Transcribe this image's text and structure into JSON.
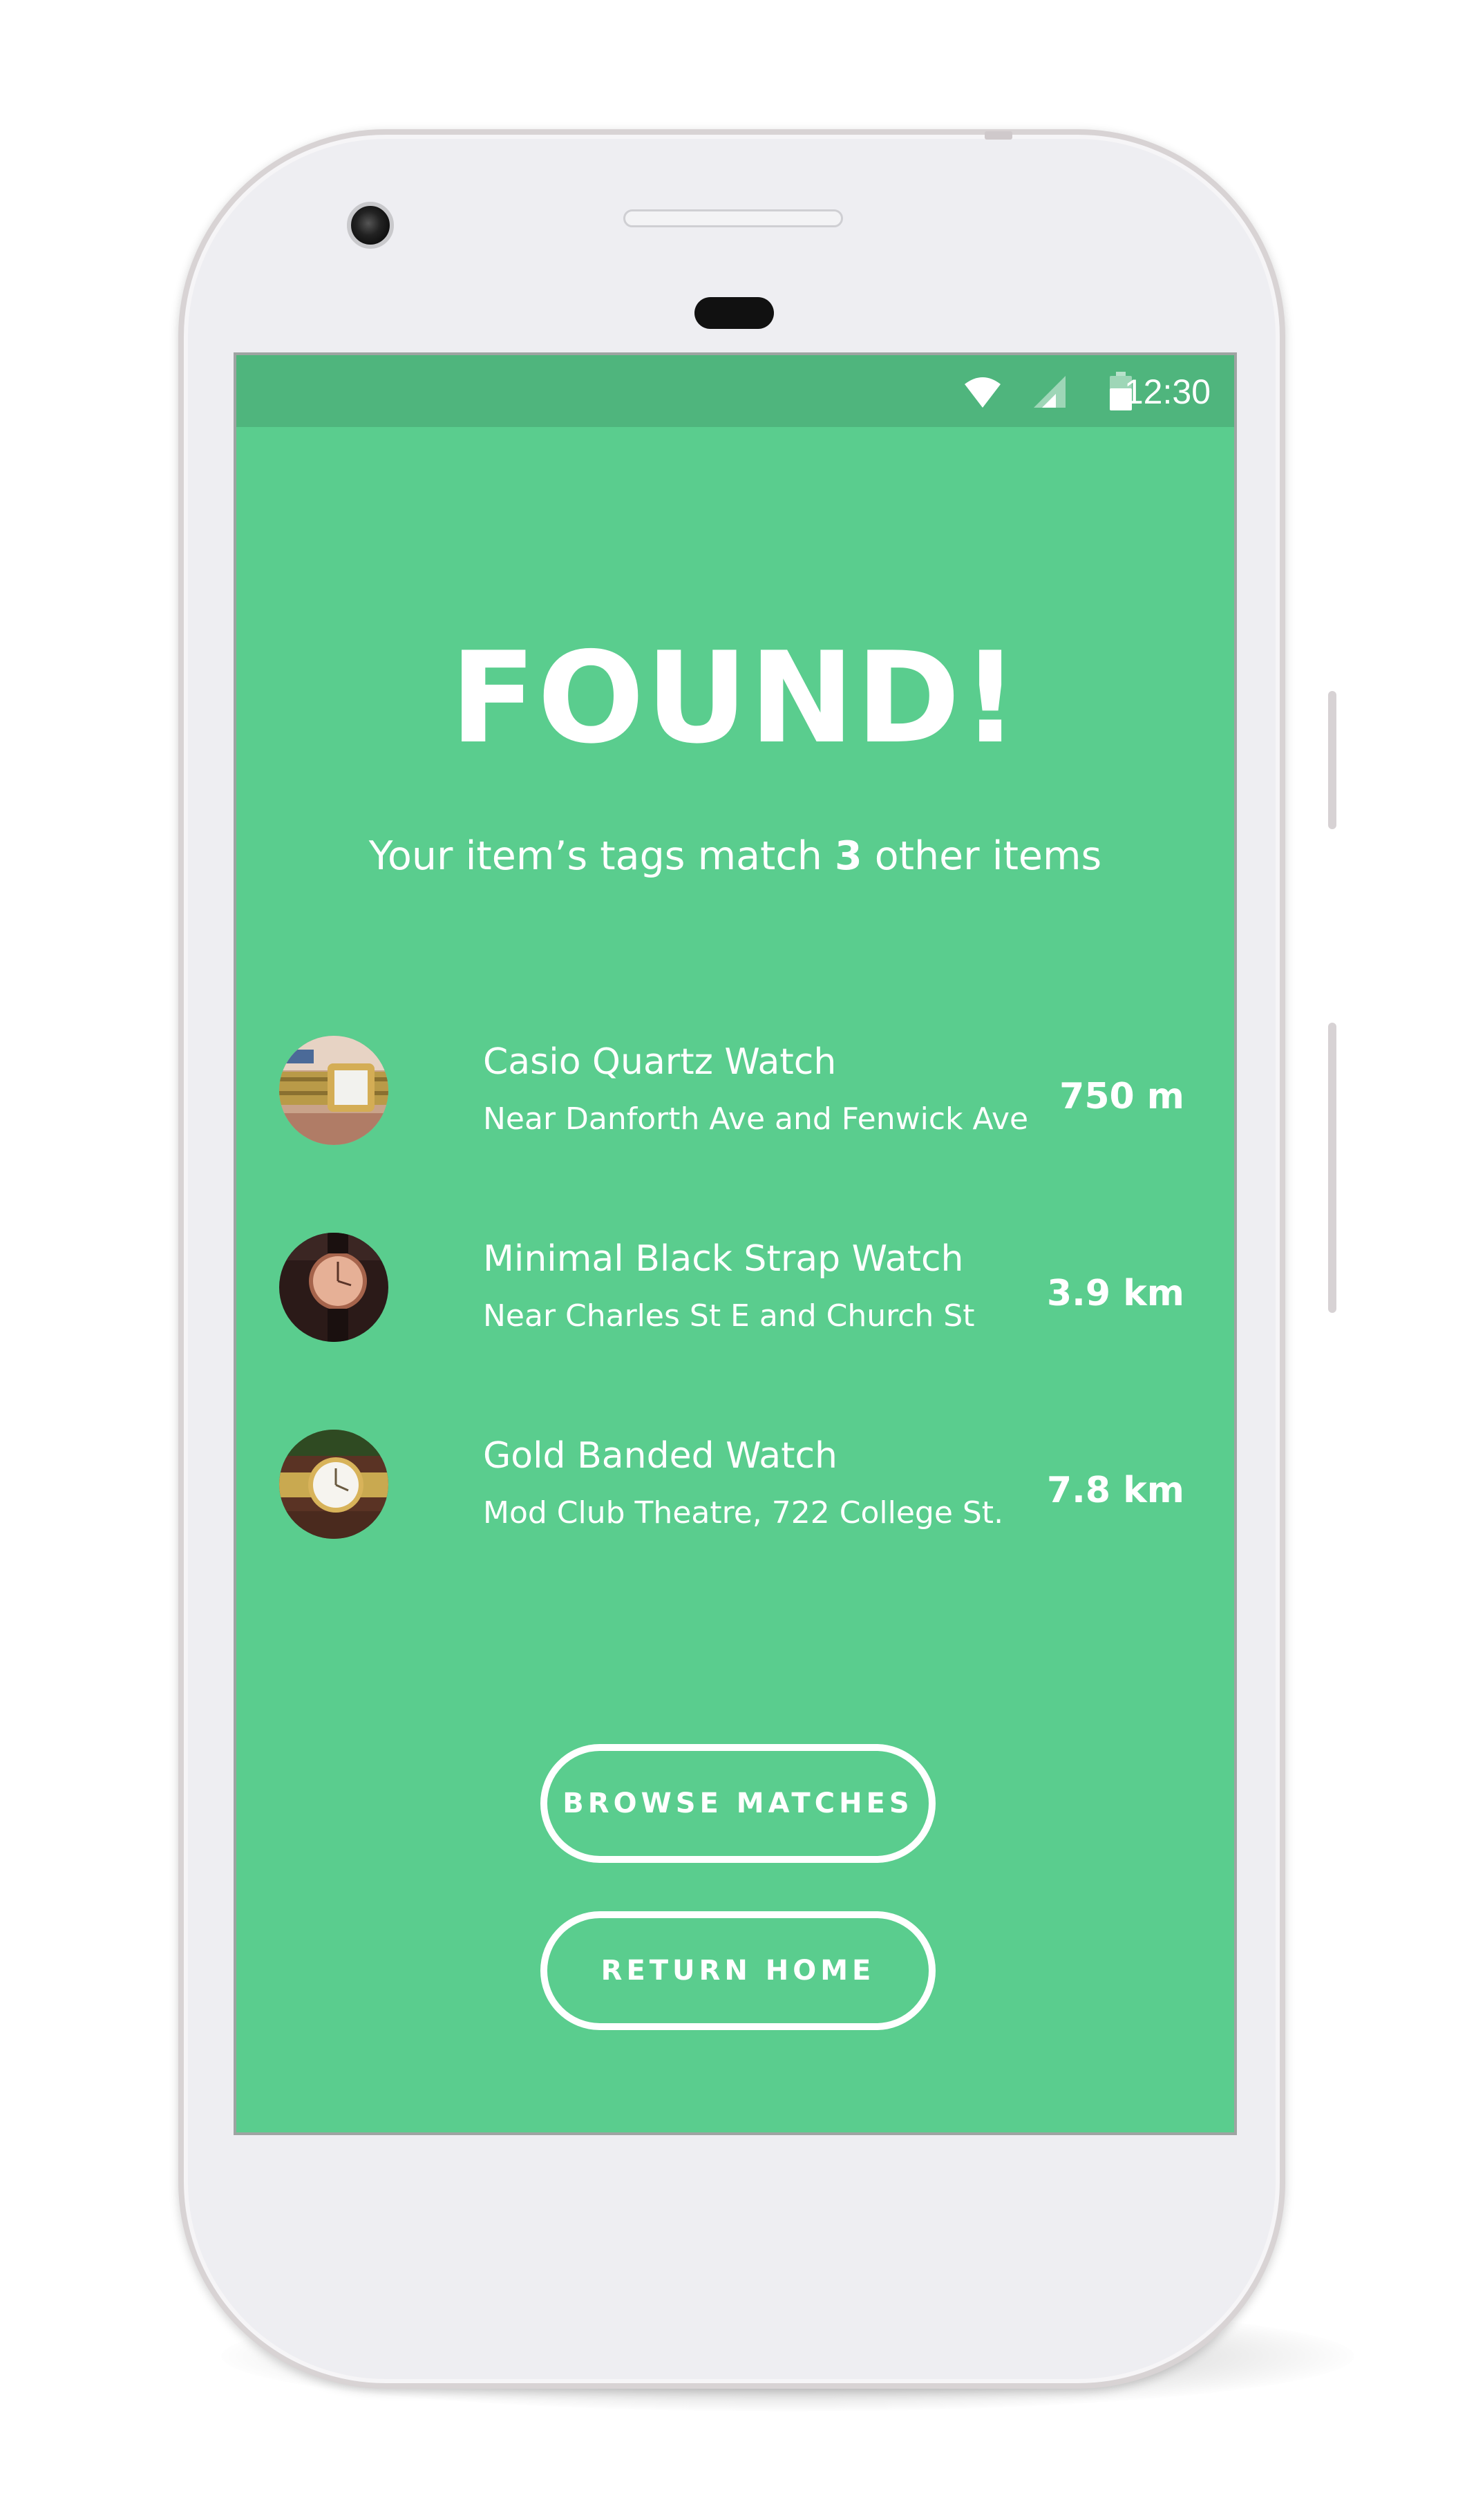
{
  "status_bar": {
    "time": "12:30",
    "icons": [
      "wifi-icon",
      "cell-signal-icon",
      "battery-icon"
    ]
  },
  "result": {
    "title": "FOUND!",
    "subtitle_prefix": "Your item’s tags match ",
    "subtitle_count": "3",
    "subtitle_suffix": " other items"
  },
  "matches": [
    {
      "name": "Casio Quartz Watch",
      "location": "Near Danforth Ave and Fenwick Ave",
      "distance": "750 m",
      "thumb": "gold-watch-thumb"
    },
    {
      "name": "Minimal Black Strap Watch",
      "location": "Near Charles St E and Church St",
      "distance": "3.9 km",
      "thumb": "rose-gold-watch-thumb"
    },
    {
      "name": "Gold Banded Watch",
      "location": "Mod Club Theatre, 722 College St.",
      "distance": "7.8 km",
      "thumb": "white-dial-watch-thumb"
    }
  ],
  "buttons": {
    "browse": "BROWSE MATCHES",
    "home": "RETURN HOME"
  },
  "colors": {
    "screen_bg": "#5acd8e",
    "status_bg": "#4fb57d",
    "text": "#ffffff"
  }
}
